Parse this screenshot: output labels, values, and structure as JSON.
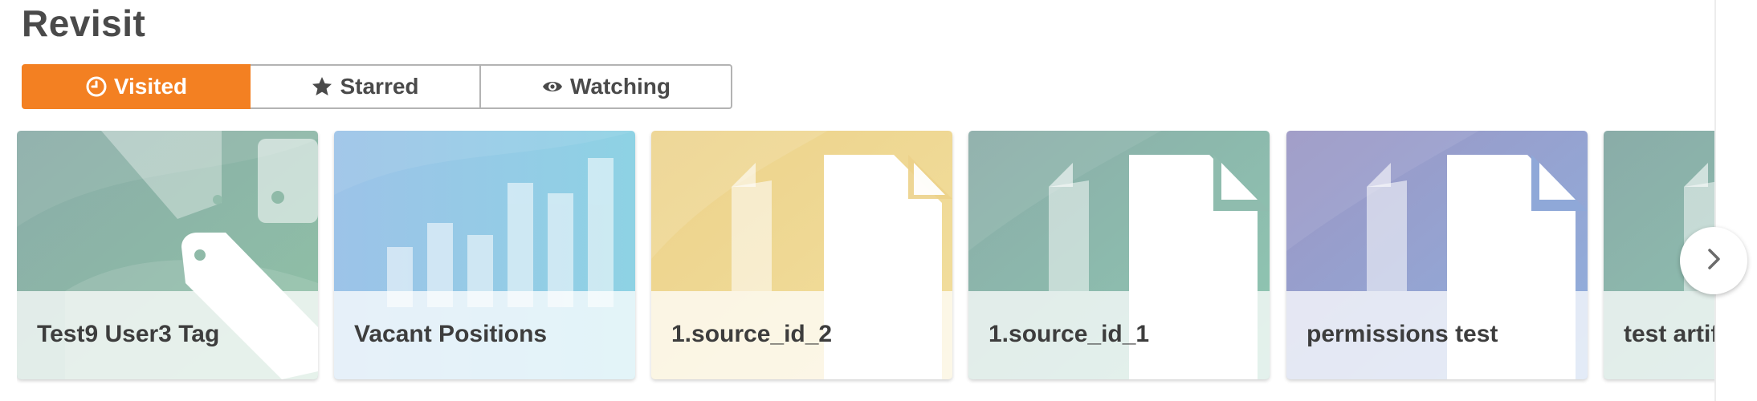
{
  "section": {
    "title": "Revisit"
  },
  "tabs": [
    {
      "label": "Visited",
      "icon": "clock-icon",
      "active": true
    },
    {
      "label": "Starred",
      "icon": "star-icon",
      "active": false
    },
    {
      "label": "Watching",
      "icon": "eye-icon",
      "active": false
    }
  ],
  "cards": [
    {
      "label": "Test9 User3 Tag",
      "icon": "tag-icon",
      "theme": "#8fb7a9"
    },
    {
      "label": "Vacant Positions",
      "icon": "bar-chart-icon",
      "theme": "#8dc4e2"
    },
    {
      "label": "1.source_id_2",
      "icon": "document-icon",
      "theme": "#ecd58f"
    },
    {
      "label": "1.source_id_1",
      "icon": "document-icon",
      "theme": "#8fbcae"
    },
    {
      "label": "permissions test",
      "icon": "document-icon",
      "theme": "#9aa3cf"
    },
    {
      "label": "test artifact",
      "icon": "document-icon",
      "theme": "#8fb7a9"
    }
  ],
  "carousel": {
    "next_icon": "chevron-right-icon"
  },
  "colors": {
    "accent": "#f38022"
  }
}
